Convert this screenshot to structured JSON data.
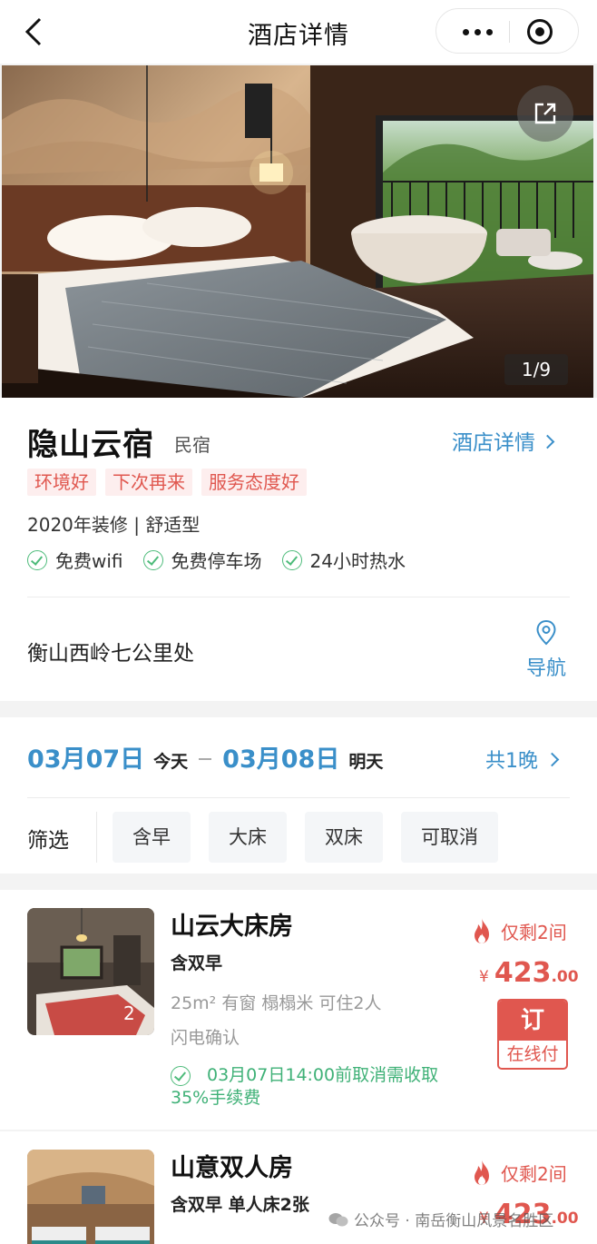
{
  "nav": {
    "title": "酒店详情"
  },
  "gallery": {
    "counter": "1/9"
  },
  "hotel": {
    "name": "隐山云宿",
    "type": "民宿",
    "detail_link": "酒店详情",
    "tags": [
      "环境好",
      "下次再来",
      "服务态度好"
    ],
    "decor": "2020年装修 | 舒适型",
    "amenities": [
      "免费wifi",
      "免费停车场",
      "24小时热水"
    ],
    "address": "衡山西岭七公里处",
    "nav_label": "导航"
  },
  "stay": {
    "checkin_date": "03月07日",
    "checkin_day": "今天",
    "checkout_date": "03月08日",
    "checkout_day": "明天",
    "nights": "共1晚"
  },
  "filter": {
    "label": "筛选",
    "chips": [
      "含早",
      "大床",
      "双床",
      "可取消"
    ]
  },
  "rooms": [
    {
      "name": "山云大床房",
      "board": "含双早",
      "spec": "25m² 有窗 榻榻米 可住2人",
      "confirm": "闪电确认",
      "cancel": "03月07日14:00前取消需收取35%手续费",
      "remaining": "仅剩2间",
      "currency": "¥",
      "price_int": "423",
      "price_dec": ".00",
      "book": "订",
      "pay": "在线付",
      "photo_count": "2"
    },
    {
      "name": "山意双人房",
      "board": "含双早 单人床2张",
      "remaining": "仅剩2间",
      "currency": "¥",
      "price_int": "423",
      "price_dec": ".00"
    }
  ],
  "watermark": "公众号 · 南岳衡山风景名胜区",
  "colors": {
    "accent_blue": "#3a8fc9",
    "alert_red": "#e0574f",
    "success_green": "#3fb177"
  }
}
